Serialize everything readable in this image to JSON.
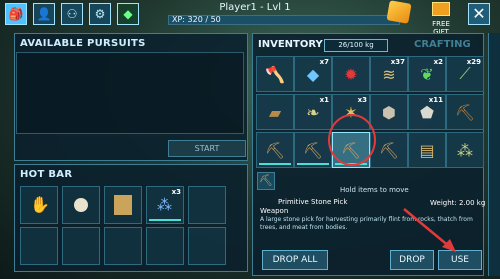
{
  "header": {
    "player_title": "Player1 - Lvl 1",
    "xp_text": "XP: 320 / 50",
    "free_gift_label": "FREE GIFT",
    "close_label": "✕"
  },
  "pursuits": {
    "title": "AVAILABLE PURSUITS",
    "start_label": "START"
  },
  "hotbar": {
    "title": "HOT BAR",
    "slots": [
      {
        "icon": "hand-icon",
        "qty": ""
      },
      {
        "icon": "note-icon",
        "qty": ""
      },
      {
        "icon": "map-icon",
        "qty": ""
      },
      {
        "icon": "berries-icon",
        "qty": "x3"
      },
      {
        "icon": "empty",
        "qty": ""
      }
    ]
  },
  "inventory": {
    "title": "INVENTORY",
    "weight": "26/100 kg",
    "crafting_tab": "CRAFTING",
    "hint": "Hold items to move",
    "items": [
      {
        "icon": "hatchet-icon",
        "qty": ""
      },
      {
        "icon": "stone-icon",
        "qty": "x7"
      },
      {
        "icon": "red-mushroom-icon",
        "qty": ""
      },
      {
        "icon": "fiber-icon",
        "qty": "x37"
      },
      {
        "icon": "green-seed-icon",
        "qty": "x2"
      },
      {
        "icon": "fiber-icon",
        "qty": "x29"
      },
      {
        "icon": "wood-icon",
        "qty": ""
      },
      {
        "icon": "leaf-icon",
        "qty": "x1"
      },
      {
        "icon": "thatch-icon",
        "qty": "x3"
      },
      {
        "icon": "rock-icon",
        "qty": ""
      },
      {
        "icon": "flint-icon",
        "qty": "x11"
      },
      {
        "icon": "pick-icon",
        "qty": ""
      },
      {
        "icon": "pick-icon",
        "qty": ""
      },
      {
        "icon": "pick-icon",
        "qty": ""
      },
      {
        "icon": "pick-icon",
        "qty": ""
      },
      {
        "icon": "note-icon",
        "qty": ""
      },
      {
        "icon": "map-icon",
        "qty": ""
      },
      {
        "icon": "berries-icon",
        "qty": ""
      }
    ],
    "selected": {
      "name_line1": "Primitive Stone Pick",
      "name_line2": "Weapon",
      "weight": "Weight: 2.00 kg",
      "description": "A large stone pick for harvesting primarily flint from rocks, thatch from trees, and meat from bodies."
    },
    "drop_all_label": "DROP ALL",
    "drop_label": "DROP",
    "use_label": "USE"
  },
  "colors": {
    "accent": "#4ae0d6",
    "highlight": "#e23a3a",
    "panel_border": "#3d7d95"
  }
}
